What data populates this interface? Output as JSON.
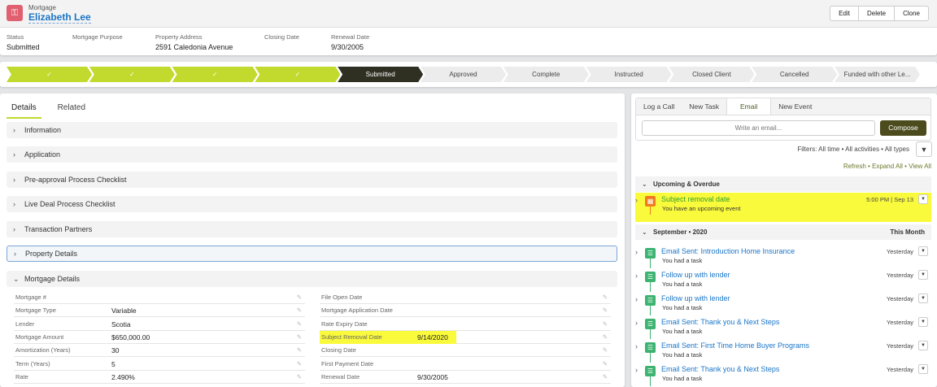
{
  "header": {
    "object_type": "Mortgage",
    "record_name": "Elizabeth Lee",
    "buttons": [
      "Edit",
      "Delete",
      "Clone"
    ],
    "fields": [
      {
        "label": "Status",
        "value": "Submitted"
      },
      {
        "label": "Mortgage Purpose",
        "value": ""
      },
      {
        "label": "Property Address",
        "value": "2591 Caledonia Avenue"
      },
      {
        "label": "Closing Date",
        "value": ""
      },
      {
        "label": "Renewal Date",
        "value": "9/30/2005"
      }
    ]
  },
  "path": {
    "check": "✓",
    "stages": [
      {
        "label": "",
        "state": "done"
      },
      {
        "label": "",
        "state": "done"
      },
      {
        "label": "",
        "state": "done"
      },
      {
        "label": "",
        "state": "done"
      },
      {
        "label": "Submitted",
        "state": "current"
      },
      {
        "label": "Approved",
        "state": "todo"
      },
      {
        "label": "Complete",
        "state": "todo"
      },
      {
        "label": "Instructed",
        "state": "todo"
      },
      {
        "label": "Closed Client",
        "state": "todo"
      },
      {
        "label": "Cancelled",
        "state": "todo"
      },
      {
        "label": "Funded with other Le...",
        "state": "todo"
      }
    ]
  },
  "details": {
    "tabs": [
      "Details",
      "Related"
    ],
    "sections": [
      "Information",
      "Application",
      "Pre-approval Process Checklist",
      "Live Deal Process Checklist",
      "Transaction Partners",
      "Property Details",
      "Mortgage Details"
    ],
    "left_fields": [
      {
        "label": "Mortgage #",
        "value": ""
      },
      {
        "label": "Mortgage Type",
        "value": "Variable"
      },
      {
        "label": "Lender",
        "value": "Scotia"
      },
      {
        "label": "Mortgage Amount",
        "value": "$650,000.00"
      },
      {
        "label": "Amortization (Years)",
        "value": "30"
      },
      {
        "label": "Term (Years)",
        "value": "5"
      },
      {
        "label": "Rate",
        "value": "2.490%"
      }
    ],
    "right_fields": [
      {
        "label": "File Open Date",
        "value": ""
      },
      {
        "label": "Mortgage Application Date",
        "value": ""
      },
      {
        "label": "Rate Expiry Date",
        "value": ""
      },
      {
        "label": "Subject Removal Date",
        "value": "9/14/2020"
      },
      {
        "label": "Closing Date",
        "value": ""
      },
      {
        "label": "First Payment Date",
        "value": ""
      },
      {
        "label": "Renewal Date",
        "value": "9/30/2005"
      }
    ]
  },
  "activity": {
    "tabs": [
      "Log a Call",
      "New Task",
      "Email",
      "New Event"
    ],
    "email_placeholder": "Write an email...",
    "compose": "Compose",
    "filters": "Filters: All time • All activities • All types",
    "links": "Refresh • Expand All • View All",
    "upcoming_label": "Upcoming & Overdue",
    "upcoming": {
      "title": "Subject removal date",
      "sub": "You have an upcoming event",
      "date": "5:00 PM | Sep 13"
    },
    "month_label": "September • 2020",
    "month_right": "This Month",
    "items": [
      {
        "title": "Email Sent: Introduction Home Insurance",
        "sub": "You had a task",
        "date": "Yesterday"
      },
      {
        "title": "Follow up with lender",
        "sub": "You had a task",
        "date": "Yesterday"
      },
      {
        "title": "Follow up with lender",
        "sub": "You had a task",
        "date": "Yesterday"
      },
      {
        "title": "Email Sent: Thank you & Next Steps",
        "sub": "You had a task",
        "date": "Yesterday"
      },
      {
        "title": "Email Sent: First Time Home Buyer Programs",
        "sub": "You had a task",
        "date": "Yesterday"
      },
      {
        "title": "Email Sent: Thank you & Next Steps",
        "sub": "You had a task",
        "date": "Yesterday"
      }
    ],
    "colors": {
      "event": "#f07c1e",
      "task": "#3cb371",
      "highlight": "#fafa3c"
    }
  }
}
